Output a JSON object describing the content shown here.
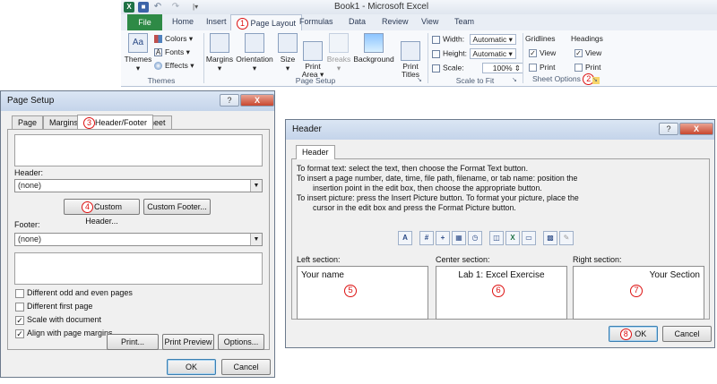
{
  "ribbon": {
    "window_title": "Book1 - Microsoft Excel",
    "qa_sep": "|▾",
    "tabs": {
      "file": "File",
      "home": "Home",
      "insert": "Insert",
      "page_layout": "Page Layout",
      "formulas": "Formulas",
      "data": "Data",
      "review": "Review",
      "view": "View",
      "team": "Team"
    },
    "themes": {
      "themes": "Themes",
      "colors": "Colors ▾",
      "fonts": "Fonts ▾",
      "effects": "Effects ▾",
      "group": "Themes"
    },
    "page_setup": {
      "margins": "Margins",
      "orientation": "Orientation",
      "size": "Size",
      "print_area": "Print\nArea ▾",
      "breaks": "Breaks",
      "background": "Background",
      "print_titles": "Print\nTitles",
      "group": "Page Setup"
    },
    "scale": {
      "width_label": "Width:",
      "width_value": "Automatic",
      "height_label": "Height:",
      "height_value": "Automatic",
      "scale_label": "Scale:",
      "scale_value": "100%",
      "group": "Scale to Fit"
    },
    "sheet_options": {
      "gridlines": "Gridlines",
      "headings": "Headings",
      "view": "View",
      "print": "Print",
      "gridlines_view_checked": true,
      "gridlines_print_checked": false,
      "headings_view_checked": true,
      "headings_print_checked": false,
      "group": "Sheet Options"
    }
  },
  "badges": {
    "b1": "1",
    "b2": "2",
    "b3": "3",
    "b4": "4",
    "b5": "5",
    "b6": "6",
    "b7": "7",
    "b8": "8"
  },
  "page_setup_dialog": {
    "title": "Page Setup",
    "help": "?",
    "close": "X",
    "tabs": {
      "page": "Page",
      "margins": "Margins",
      "header_footer": "Header/Footer",
      "sheet": "Sheet"
    },
    "header_label": "Header:",
    "header_value": "(none)",
    "custom_header": "Custom Header...",
    "custom_footer": "Custom Footer...",
    "footer_label": "Footer:",
    "footer_value": "(none)",
    "options": [
      {
        "label": "Different odd and even pages",
        "checked": false
      },
      {
        "label": "Different first page",
        "checked": false
      },
      {
        "label": "Scale with document",
        "checked": true
      },
      {
        "label": "Align with page margins",
        "checked": true
      }
    ],
    "print": "Print...",
    "print_preview": "Print Preview",
    "options_btn": "Options...",
    "ok": "OK",
    "cancel": "Cancel"
  },
  "header_dialog": {
    "title": "Header",
    "help": "?",
    "close": "X",
    "tab": "Header",
    "instructions": [
      "To format text:  select the text, then choose the Format Text button.",
      "To insert a page number, date, time, file path, filename, or tab name:  position the",
      "insertion point in the edit box, then choose the appropriate button.",
      "To insert picture: press the Insert Picture button.  To format your picture, place the",
      "cursor in the edit box and press the Format Picture button."
    ],
    "left_label": "Left section:",
    "center_label": "Center section:",
    "right_label": "Right section:",
    "left_text": "Your name",
    "center_text": "Lab 1: Excel Exercise",
    "right_text": "Your Section",
    "ok": "OK",
    "cancel": "Cancel"
  }
}
